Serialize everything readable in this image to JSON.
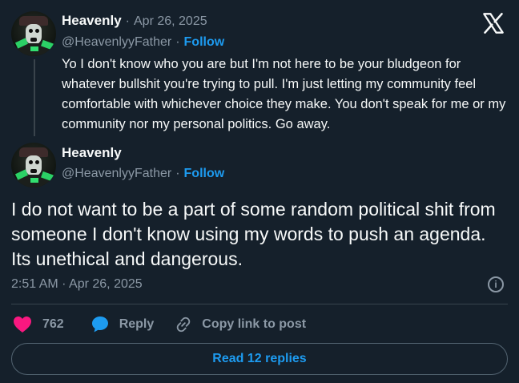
{
  "colors": {
    "background": "#15202b",
    "accent": "#1d9bf0",
    "like": "#f91880",
    "muted": "#8b98a5"
  },
  "brand": {
    "icon": "x-logo-icon"
  },
  "reply_tweet": {
    "name": "Heavenly",
    "separator": "·",
    "date": "Apr 26, 2025",
    "handle": "@HeavenlyyFather",
    "follow_label": "Follow",
    "text": "Yo I don't know who you are but I'm not here to be your bludgeon for whatever bullshit you're trying to pull.  I'm just letting my community feel comfortable with whichever choice they make. You don't speak for me or my community nor my personal politics.  Go away."
  },
  "main_tweet": {
    "name": "Heavenly",
    "handle": "@HeavenlyyFather",
    "separator": "·",
    "follow_label": "Follow",
    "text": "I do not want to be a part of some random political shit from someone I don't know using my words to push an agenda.  Its unethical and dangerous.",
    "timestamp": "2:51 AM · Apr 26, 2025",
    "info_icon": "info-icon"
  },
  "actions": {
    "likes": "762",
    "reply_label": "Reply",
    "copy_link_label": "Copy link to post"
  },
  "read_replies_label": "Read 12 replies"
}
